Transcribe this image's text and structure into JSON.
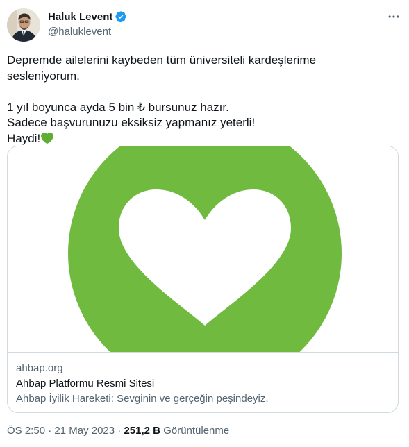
{
  "author": {
    "display_name": "Haluk Levent",
    "handle": "@haluklevent",
    "verified": true
  },
  "tweet": {
    "line1": "Depremde ailelerini kaybeden tüm üniversiteli kardeşlerime",
    "line2": "sesleniyorum.",
    "line3": "1 yıl boyunca ayda 5 bin ₺ bursunuz hazır.",
    "line4": "Sadece başvurunuzu eksiksiz yapmanız yeterli!",
    "line5": "Haydi!",
    "emoji": "green-heart"
  },
  "card": {
    "domain": "ahbap.org",
    "title": "Ahbap Platformu Resmi Sitesi",
    "description": "Ahbap İyilik Hareketi: Sevginin ve gerçeğin peşindeyiz.",
    "image": "white-heart-on-green-circle"
  },
  "meta": {
    "time": "ÖS 2:50",
    "separator": "·",
    "date": "21 May 2023",
    "views_count": "251,2 B",
    "views_label": "Görüntülenme"
  },
  "colors": {
    "verified_blue": "#1d9bf0",
    "ahbap_green": "#6fba3f",
    "text_primary": "#0f1419",
    "text_secondary": "#536471",
    "border": "#cfd9de"
  }
}
